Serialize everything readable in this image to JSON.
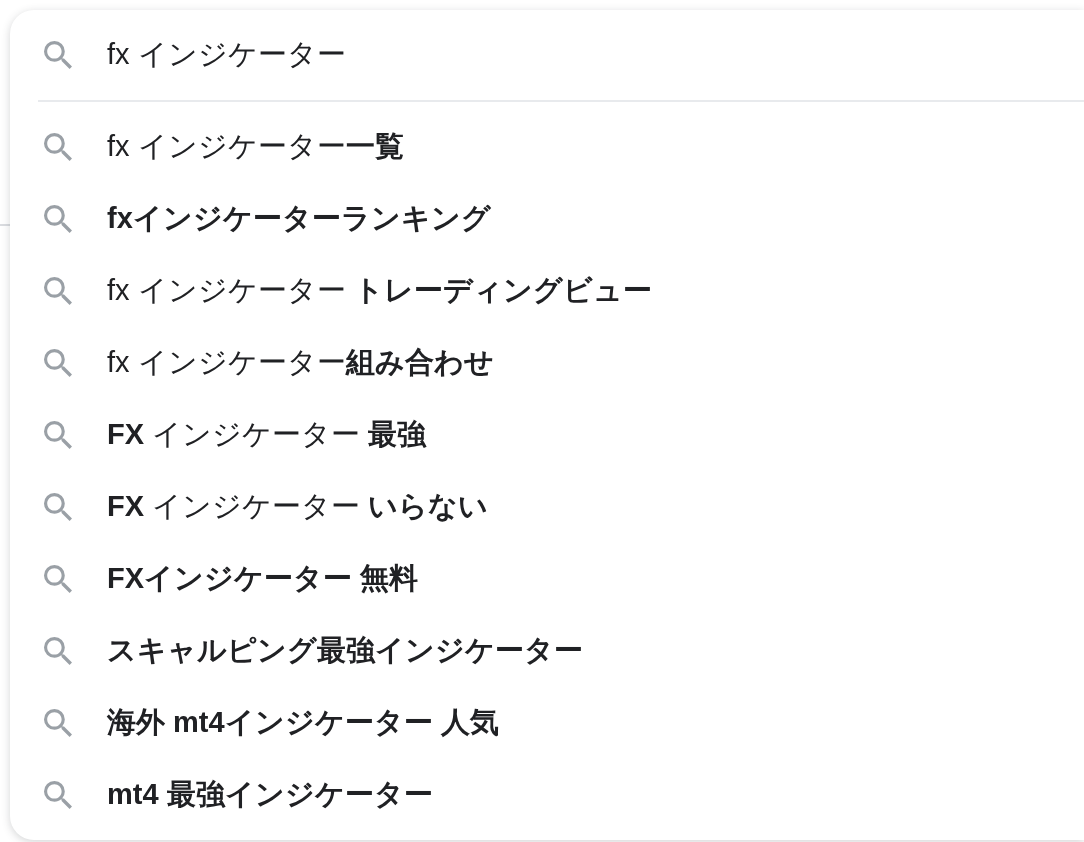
{
  "search": {
    "value": "fx インジケーター"
  },
  "suggestions": [
    {
      "text": "fx インジケーター**一覧**",
      "bold": false
    },
    {
      "text": "fxインジケーターランキング",
      "bold": true
    },
    {
      "text": "fx インジケーター **トレーディングビュー**",
      "bold": false
    },
    {
      "text": "fx インジケーター**組み合わせ**",
      "bold": false
    },
    {
      "text": "**FX** インジケーター **最強**",
      "bold": false
    },
    {
      "text": "**FX** インジケーター **いらない**",
      "bold": false
    },
    {
      "text": "FXインジケーター 無料",
      "bold": true
    },
    {
      "text": "スキャルピング最強インジケーター",
      "bold": true
    },
    {
      "text": "海外 mt4インジケーター 人気",
      "bold": true
    },
    {
      "text": "mt4 最強インジケーター",
      "bold": true
    }
  ]
}
